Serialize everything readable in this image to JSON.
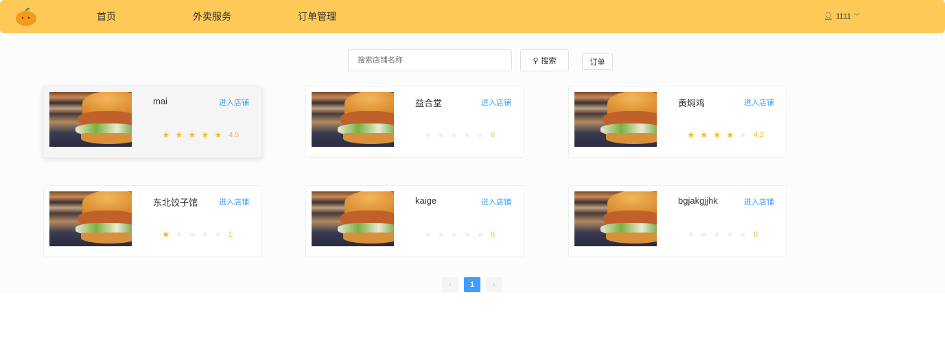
{
  "nav": {
    "items": [
      "首页",
      "外卖服务",
      "订单管理"
    ],
    "user": "1111"
  },
  "search": {
    "placeholder": "搜索店铺名称",
    "button": "搜索",
    "orders": "订单"
  },
  "shops": [
    {
      "name": "mai",
      "enter": "进入店铺",
      "rating": 4.5,
      "rating_text": "4.5"
    },
    {
      "name": "益合堂",
      "enter": "进入店铺",
      "rating": 0,
      "rating_text": "0"
    },
    {
      "name": "黄焖鸡",
      "enter": "进入店铺",
      "rating": 4.2,
      "rating_text": "4.2"
    },
    {
      "name": "东北饺子馆",
      "enter": "进入店铺",
      "rating": 1,
      "rating_text": "1"
    },
    {
      "name": "kaige",
      "enter": "进入店铺",
      "rating": 0,
      "rating_text": "0"
    },
    {
      "name": "bgjakgjjhk",
      "enter": "进入店铺",
      "rating": 0,
      "rating_text": "0"
    }
  ],
  "pagination": {
    "current": "1",
    "prev": "‹",
    "next": "›"
  },
  "colors": {
    "nav": "#ffc957",
    "accent": "#409eff",
    "star": "#f7ba2a"
  }
}
